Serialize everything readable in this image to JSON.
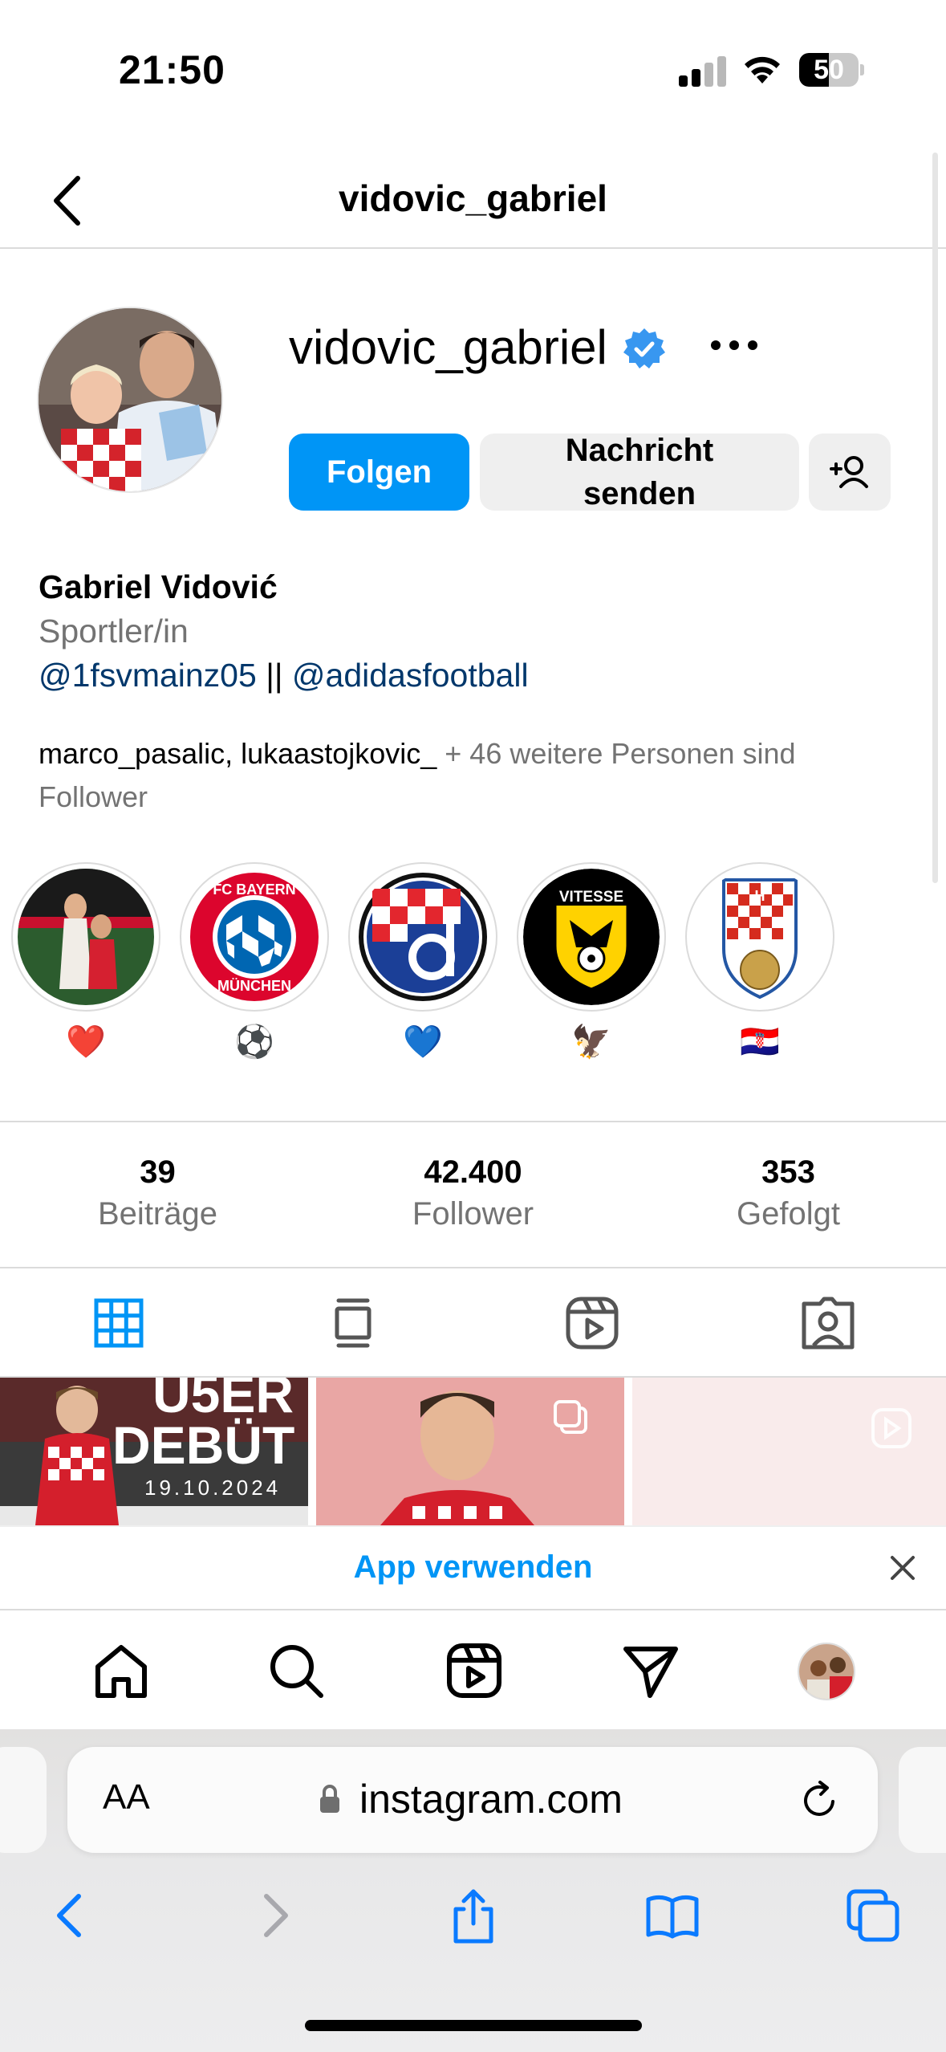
{
  "status_bar": {
    "time": "21:50",
    "battery": "50",
    "battery_level": 0.5
  },
  "header": {
    "title": "vidovic_gabriel"
  },
  "profile": {
    "username": "vidovic_gabriel",
    "follow_label": "Folgen",
    "message_label": "Nachricht senden",
    "full_name": "Gabriel Vidović",
    "category": "Sportler/in",
    "bio_link_1": "@1fsvmainz05",
    "bio_separator": "||",
    "bio_link_2": "@adidasfootball",
    "followed_by_1": "marco_pasalic",
    "followed_by_2": "lukaastojkovic_",
    "followed_by_rest": "+ 46 weitere Personen sind Follower"
  },
  "highlights": [
    {
      "label": "❤️",
      "icon": "photo-couple"
    },
    {
      "label": "⚽",
      "icon": "fc-bayern-logo"
    },
    {
      "label": "💙",
      "icon": "dinamo-zagreb-logo"
    },
    {
      "label": "🦅",
      "icon": "vitesse-logo"
    },
    {
      "label": "🇭🇷",
      "icon": "hns-logo"
    }
  ],
  "stats": [
    {
      "value": "39",
      "label": "Beiträge"
    },
    {
      "value": "42.400",
      "label": "Follower"
    },
    {
      "value": "353",
      "label": "Gefolgt"
    }
  ],
  "posts": [
    {
      "text_1": "U5ER",
      "text_2": "DEBÜT",
      "date": "19.10.2024"
    }
  ],
  "app_banner": {
    "label": "App verwenden"
  },
  "safari": {
    "aa": "AA",
    "url": "instagram.com"
  },
  "colors": {
    "accent": "#0095f6",
    "link": "#00376b",
    "muted": "#737373",
    "verified": "#3897f0"
  }
}
